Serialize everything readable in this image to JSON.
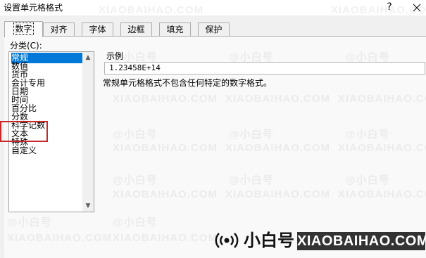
{
  "window": {
    "title": "设置单元格格式",
    "help_label": "?",
    "close_icon": "close-icon"
  },
  "tabs": [
    {
      "label": "数字",
      "active": true
    },
    {
      "label": "对齐",
      "active": false
    },
    {
      "label": "字体",
      "active": false
    },
    {
      "label": "边框",
      "active": false
    },
    {
      "label": "填充",
      "active": false
    },
    {
      "label": "保护",
      "active": false
    }
  ],
  "category": {
    "label": "分类(C):",
    "items": [
      "常规",
      "数值",
      "货币",
      "会计专用",
      "日期",
      "时间",
      "百分比",
      "分数",
      "科学记数",
      "文本",
      "特殊",
      "自定义"
    ],
    "selected": "常规",
    "highlighted": [
      "科学记数",
      "文本"
    ]
  },
  "sample": {
    "label": "示例",
    "value": "1.23458E+14"
  },
  "description": "常规单元格格式不包含任何特定的数字格式。",
  "watermark": {
    "text_cn": "@小白号",
    "text_en": "XIAOBAIHAO.COM"
  },
  "logo": {
    "icon": "broadcast-icon",
    "text_cn": "小白号",
    "text_en": "XIAOBAIHAO.COM"
  },
  "colors": {
    "selection": "#0078d7",
    "highlight_box": "#c8272c"
  }
}
